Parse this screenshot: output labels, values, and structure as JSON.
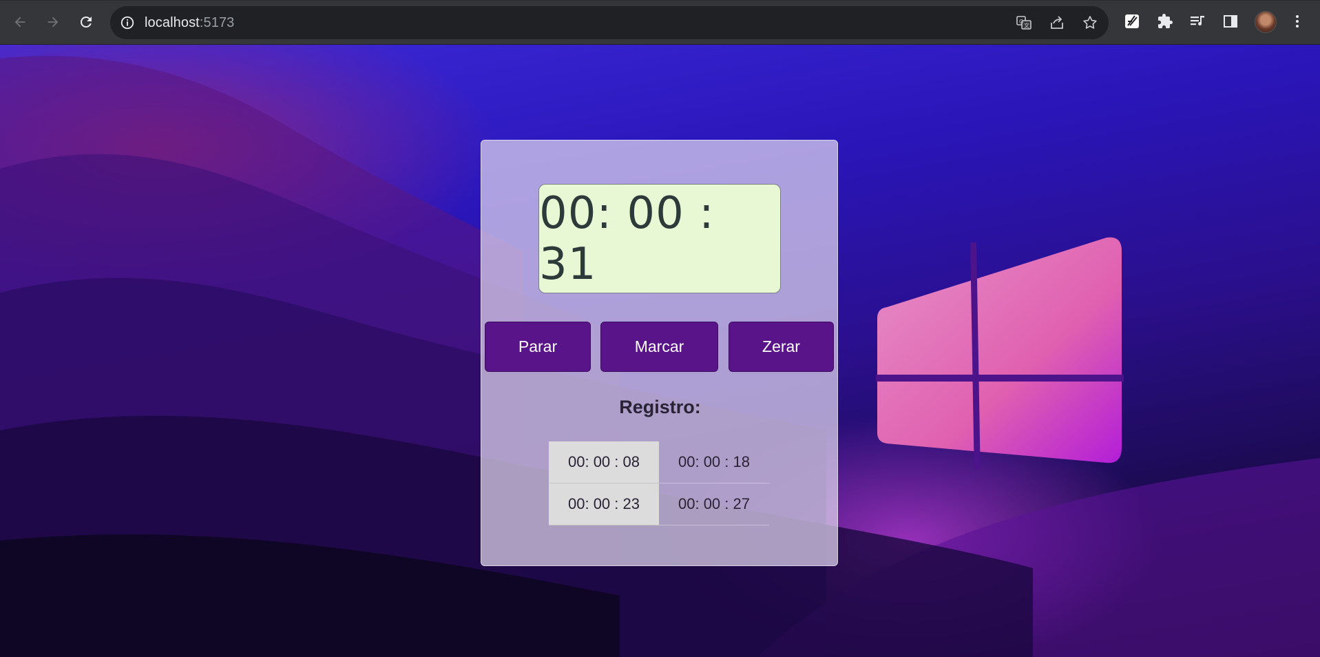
{
  "browser": {
    "url_host": "localhost",
    "url_port": ":5173",
    "icons": {
      "back": "arrow-left-icon",
      "forward": "arrow-right-icon",
      "reload": "reload-icon",
      "site_info": "info-icon",
      "translate": "translate-icon",
      "share": "share-icon",
      "bookmark": "star-icon",
      "extension_app": "extension-app-icon",
      "extensions": "puzzle-icon",
      "media": "playlist-icon",
      "side_panel": "side-panel-icon",
      "profile": "avatar",
      "menu": "kebab-menu-icon"
    }
  },
  "stopwatch": {
    "display": "00: 00 : 31",
    "buttons": {
      "stop": "Parar",
      "mark": "Marcar",
      "reset": "Zerar"
    },
    "registro_title": "Registro:",
    "laps": [
      [
        "00: 00 : 08",
        "00: 00 : 18"
      ],
      [
        "00: 00 : 23",
        "00: 00 : 27"
      ]
    ]
  },
  "colors": {
    "button_bg": "#5a148a",
    "display_bg": "#e8f8d4",
    "chrome_bg": "#35363a",
    "omnibox_bg": "#202124",
    "logo_pink": "#e070b0"
  }
}
